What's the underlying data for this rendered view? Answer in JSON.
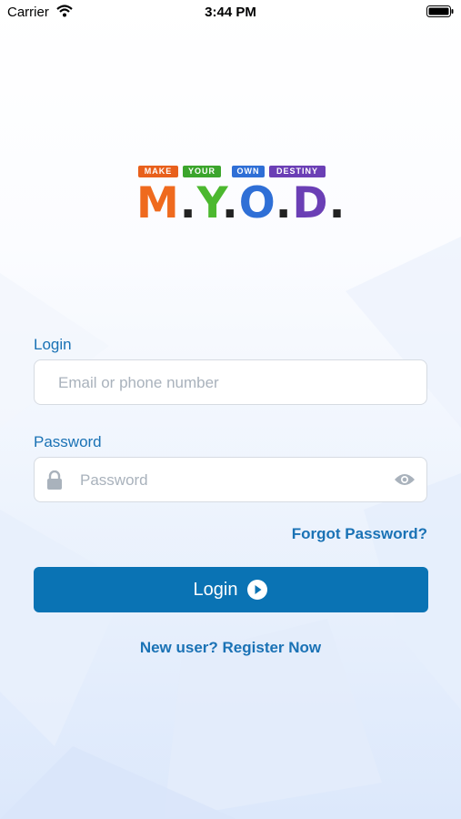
{
  "status_bar": {
    "carrier": "Carrier",
    "time": "3:44 PM"
  },
  "logo": {
    "tagline_words": [
      "MAKE",
      "YOUR",
      "OWN",
      "DESTINY"
    ],
    "letters": [
      "M",
      ".",
      "Y",
      ".",
      "O",
      ".",
      "D",
      "."
    ],
    "colors": {
      "make": "#e8601c",
      "your": "#3ba52c",
      "own": "#2f6fd6",
      "destiny": "#6b3fb5"
    }
  },
  "form": {
    "login_label": "Login",
    "login_placeholder": "Email or phone number",
    "password_label": "Password",
    "password_placeholder": "Password",
    "forgot_password": "Forgot Password?",
    "login_button": "Login",
    "register_link": "New user? Register Now"
  },
  "icons": {
    "lock": "lock-icon",
    "eye": "eye-icon",
    "arrow": "arrow-right-circle-icon"
  },
  "accent_color": "#0a73b4"
}
